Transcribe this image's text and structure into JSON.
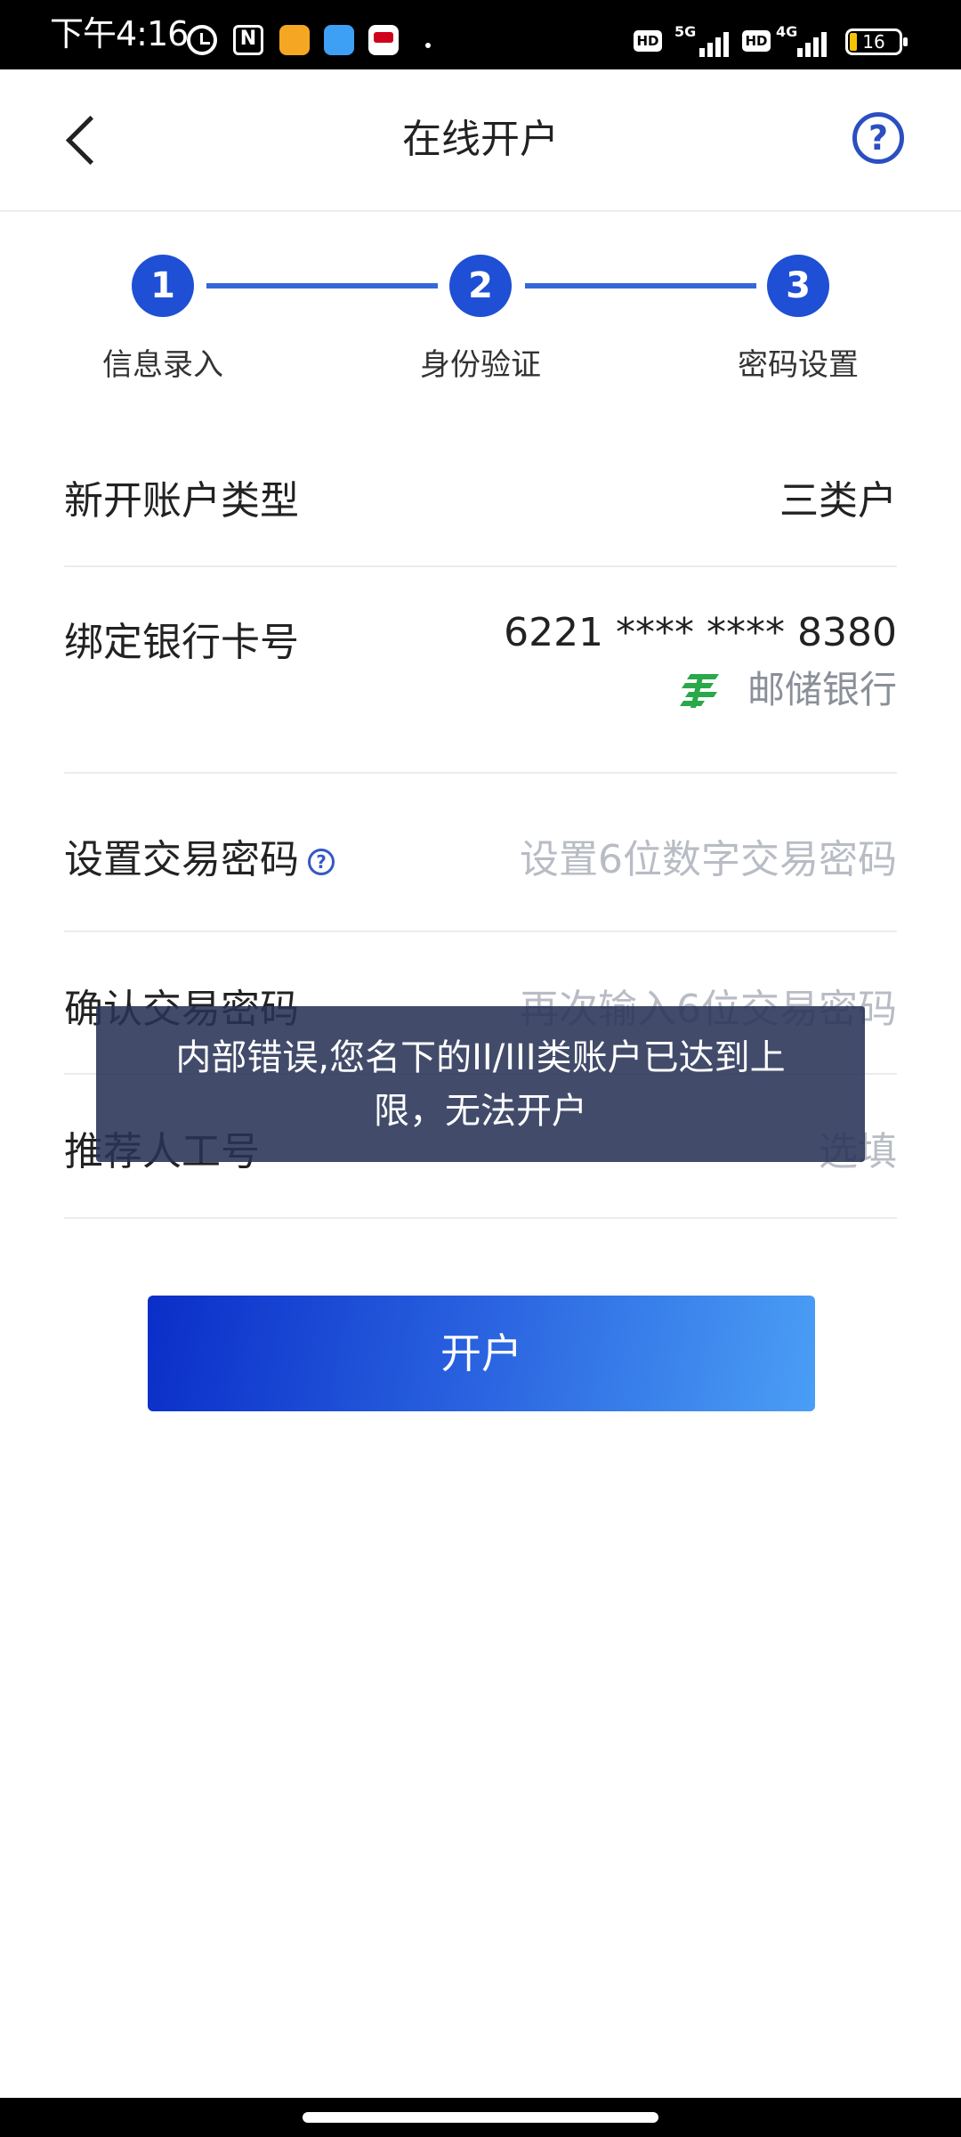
{
  "status_bar": {
    "time": "下午4:16",
    "network1": "5G",
    "network2": "4G",
    "hd_label": "HD",
    "battery": "16"
  },
  "header": {
    "title": "在线开户",
    "help": "?"
  },
  "steps": [
    {
      "number": "1",
      "label": "信息录入"
    },
    {
      "number": "2",
      "label": "身份验证"
    },
    {
      "number": "3",
      "label": "密码设置"
    }
  ],
  "form": {
    "account_type": {
      "label": "新开账户类型",
      "value": "三类户"
    },
    "bank_card": {
      "label": "绑定银行卡号",
      "value": "6221 **** **** 8380",
      "bank": "邮储银行"
    },
    "trade_password": {
      "label": "设置交易密码",
      "placeholder": "设置6位数字交易密码"
    },
    "confirm_password": {
      "label": "确认交易密码",
      "placeholder": "再次输入6位交易密码"
    },
    "referrer": {
      "label": "推荐人工号",
      "placeholder": "选填"
    }
  },
  "submit_label": "开户",
  "toast": {
    "line1": "内部错误,您名下的II/III类账户已达到上",
    "line2": "限，无法开户"
  },
  "colors": {
    "primary": "#1e4fd4",
    "bank_green": "#2aa84a",
    "toast_bg": "#283255"
  }
}
